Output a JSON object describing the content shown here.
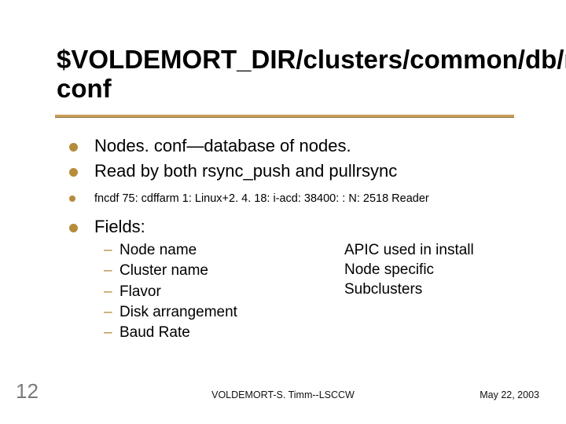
{
  "title": "$VOLDEMORT_DIR/clusters/common/db/nodes. conf",
  "bullets": {
    "b1": "Nodes. conf—database of nodes.",
    "b2": "Read by both rsync_push and pullrsync",
    "b3": "fncdf 75: cdffarm 1: Linux+2. 4. 18: i-acd: 38400: : N: 2518 Reader",
    "b4": "Fields:"
  },
  "sub": {
    "s1": "Node name",
    "s2": "Cluster name",
    "s3": "Flavor",
    "s4": "Disk arrangement",
    "s5": "Baud Rate"
  },
  "right": {
    "r1": "APIC used in install",
    "r2": "Node specific",
    "r3": "Subclusters"
  },
  "footer": {
    "page": "12",
    "center": "VOLDEMORT-S. Timm--LSCCW",
    "date": "May 22, 2003"
  }
}
